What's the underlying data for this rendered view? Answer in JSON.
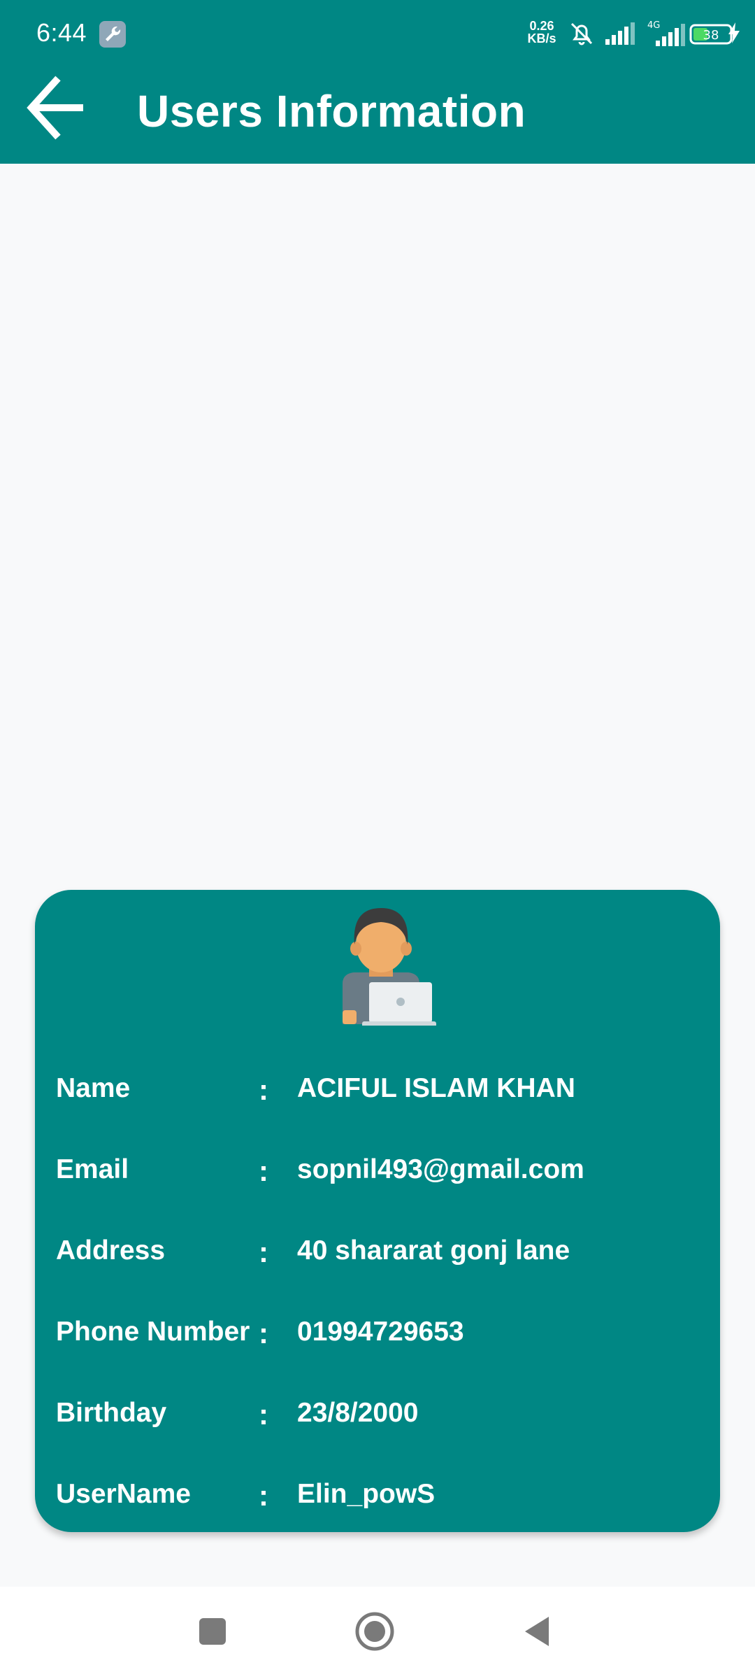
{
  "status_bar": {
    "time": "6:44",
    "net_speed_value": "0.26",
    "net_speed_unit": "KB/s",
    "network_type": "4G",
    "battery_level": "38"
  },
  "app_bar": {
    "title": "Users Information"
  },
  "profile": {
    "rows": [
      {
        "label": "Name",
        "colon": ":",
        "value": "ACIFUL ISLAM KHAN"
      },
      {
        "label": "Email",
        "colon": ":",
        "value": "sopnil493@gmail.com"
      },
      {
        "label": "Address",
        "colon": ":",
        "value": "40 shararat gonj lane"
      },
      {
        "label": "Phone Number",
        "colon": ":",
        "value": "01994729653"
      },
      {
        "label": "Birthday",
        "colon": ":",
        "value": "23/8/2000"
      },
      {
        "label": "UserName",
        "colon": ":",
        "value": "Elin_powS"
      }
    ]
  },
  "colors": {
    "primary": "#008784",
    "background": "#f8f9fa",
    "text_on_primary": "#ffffff"
  },
  "icons": {
    "back": "arrow-left-icon",
    "avatar": "user-laptop-avatar-icon",
    "nav_recents": "square-icon",
    "nav_home": "circle-icon",
    "nav_back": "triangle-back-icon"
  }
}
